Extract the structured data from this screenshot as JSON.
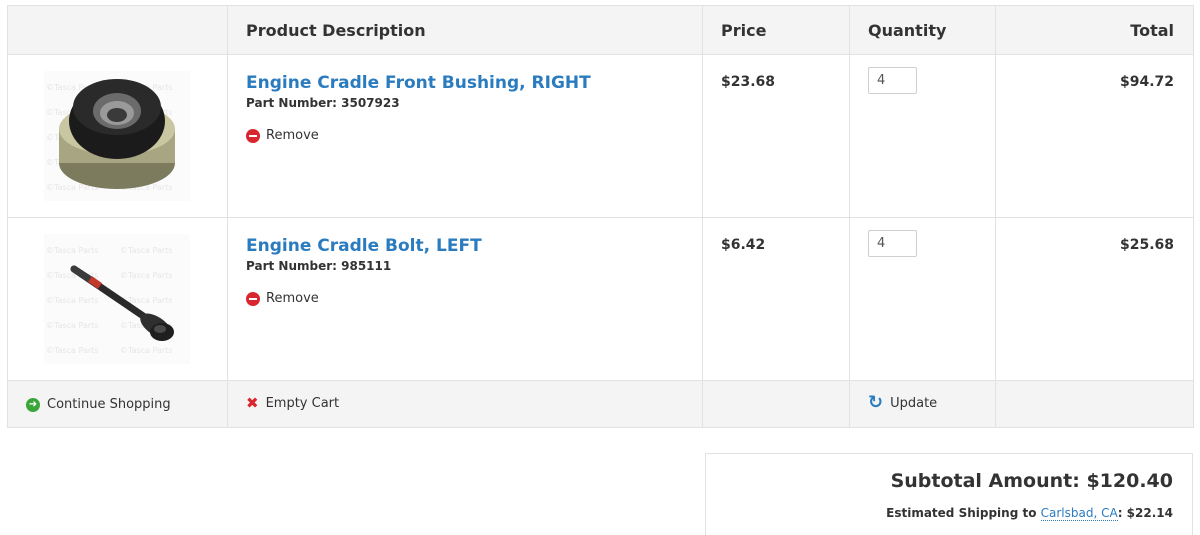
{
  "table": {
    "headers": {
      "description": "Product Description",
      "price": "Price",
      "quantity": "Quantity",
      "total": "Total"
    },
    "watermark": "©Tasca Parts",
    "items": [
      {
        "name": "Engine Cradle Front Bushing, RIGHT",
        "part_label": "Part Number: 3507923",
        "remove_label": "Remove",
        "price": "$23.68",
        "quantity": "4",
        "total": "$94.72",
        "image_icon": "bushing-image"
      },
      {
        "name": "Engine Cradle Bolt, LEFT",
        "part_label": "Part Number: 985111",
        "remove_label": "Remove",
        "price": "$6.42",
        "quantity": "4",
        "total": "$25.68",
        "image_icon": "bolt-image"
      }
    ],
    "footer": {
      "continue_label": "Continue Shopping",
      "empty_label": "Empty Cart",
      "update_label": "Update"
    }
  },
  "summary": {
    "subtotal": "Subtotal Amount: $120.40",
    "shipping_prefix": "Estimated Shipping to ",
    "shipping_location": "Carlsbad, CA",
    "shipping_suffix": ": $22.14"
  },
  "colors": {
    "link": "#2b7bbf",
    "remove": "#d9262e",
    "continue": "#3aa63a",
    "header_bg": "#f4f4f4"
  }
}
